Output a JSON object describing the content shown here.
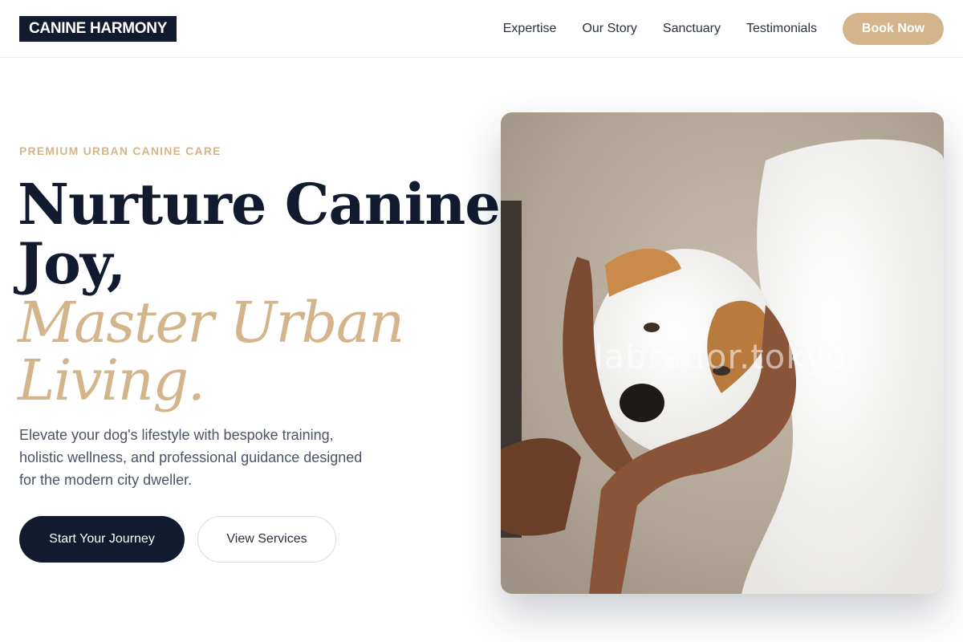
{
  "header": {
    "logo": "CANINE HARMONY",
    "nav": [
      "Expertise",
      "Our Story",
      "Sanctuary",
      "Testimonials"
    ],
    "cta": "Book Now"
  },
  "hero": {
    "eyebrow": "PREMIUM URBAN CANINE CARE",
    "headline_line1": "Nurture Canine",
    "headline_line2": "Joy,",
    "accent_line1": "Master Urban",
    "accent_line2": "Living.",
    "lede": "Elevate your dog's lifestyle with bespoke training, holistic wellness, and professional guidance designed for the modern city dweller.",
    "primary_button": "Start Your Journey",
    "secondary_button": "View Services",
    "image_watermark": "labrador.tokyo"
  },
  "colors": {
    "navy": "#111a2e",
    "accent": "#d4b48a",
    "text_muted": "#4a5466"
  }
}
